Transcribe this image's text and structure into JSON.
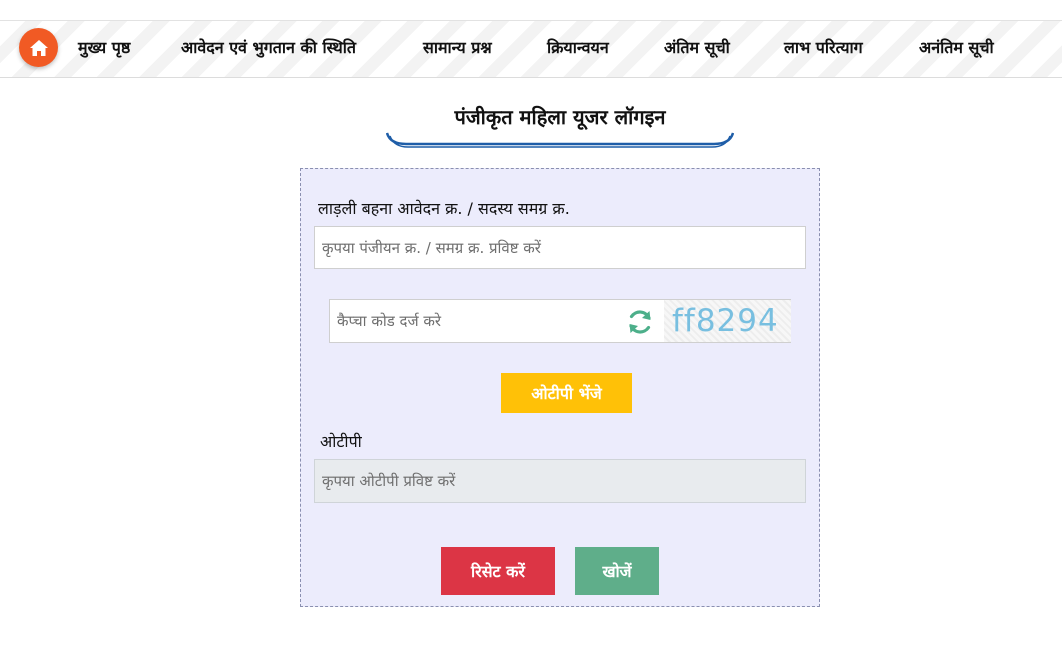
{
  "nav": {
    "home_icon": "home-icon",
    "items": [
      {
        "label": "मुख्य पृष्ठ"
      },
      {
        "label": "आवेदन एवं भुगतान की स्थिति"
      },
      {
        "label": "सामान्य प्रश्न"
      },
      {
        "label": "क्रियान्वयन"
      },
      {
        "label": "अंतिम सूची"
      },
      {
        "label": "लाभ परित्याग"
      },
      {
        "label": "अनंतिम सूची"
      }
    ]
  },
  "page": {
    "title": "पंजीकृत महिला यूजर लॉगइन"
  },
  "form": {
    "id_label": "लाड़ली बहना आवेदन क्र. / सदस्य समग्र क्र.",
    "id_placeholder": "कृपया पंजीयन क्र. / समग्र क्र. प्रविष्ट करें",
    "captcha_placeholder": "कैप्चा कोड दर्ज करे",
    "captcha_text": "ff8294",
    "refresh_icon": "refresh-icon",
    "send_otp_label": "ओटीपी भेंजे",
    "otp_label": "ओटीपी",
    "otp_placeholder": "कृपया ओटीपी प्रविष्ट करें",
    "reset_label": "रिसेट करें",
    "search_label": "खोजें"
  },
  "colors": {
    "home_button": "#f15a24",
    "panel_bg": "#ececfc",
    "otp_button": "#ffc107",
    "reset_button": "#dc3545",
    "search_button": "#5fae8a",
    "title_underline": "#1f5ea8",
    "captcha_text": "#78bfe0",
    "refresh_icon": "#4caf8a"
  }
}
